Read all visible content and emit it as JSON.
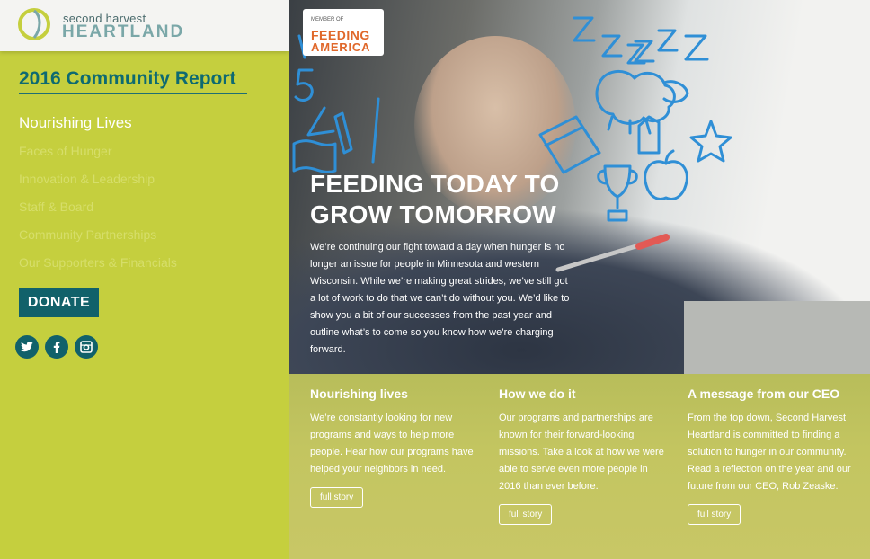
{
  "logo": {
    "line1": "second harvest",
    "line2": "HEARTLAND",
    "icon": "second-harvest-leaf-logo"
  },
  "sidebar": {
    "report_title": "2016 Community Report",
    "current_section": "Nourishing Lives",
    "nav_items": [
      "Faces of Hunger",
      "Innovation & Leadership",
      "Staff & Board",
      "Community Partnerships",
      "Our Supporters & Financials"
    ],
    "donate_label": "DONATE",
    "social": [
      "twitter-icon",
      "facebook-icon",
      "instagram-icon"
    ]
  },
  "badge": {
    "top": "MEMBER OF",
    "line1": "FEEDING",
    "line2": "AMERICA"
  },
  "hero": {
    "title": "FEEDING TODAY TO GROW TOMORROW",
    "body": "We’re continuing our fight toward a day when hunger is no longer an issue for people in Minnesota and western Wisconsin. While we’re making great strides, we’ve still got a lot of work to do that we can’t do without you. We’d like to show you a bit of our successes from the past year and outline what’s to come so you know how we’re charging forward."
  },
  "stories": [
    {
      "title": "Nourishing lives",
      "body": "We’re constantly looking for new programs and ways to help more people. Hear how our programs have helped your neighbors in need.",
      "button": "full story"
    },
    {
      "title": "How we do it",
      "body": "Our programs and partnerships are known for their forward-looking missions. Take a look at how we were able to serve even more people in 2016 than ever before.",
      "button": "full story"
    },
    {
      "title": "A message from our CEO",
      "body": "From the top down, Second Harvest Heartland is committed to finding a solution to hunger in our community. Read a reflection on the year and our future from our CEO, Rob Zeaske.",
      "button": "full story"
    }
  ],
  "colors": {
    "sidebar_bg": "#c5cf3e",
    "teal": "#11616a",
    "doodle_blue": "#2f8fd6",
    "feeding_orange": "#e0682b"
  }
}
